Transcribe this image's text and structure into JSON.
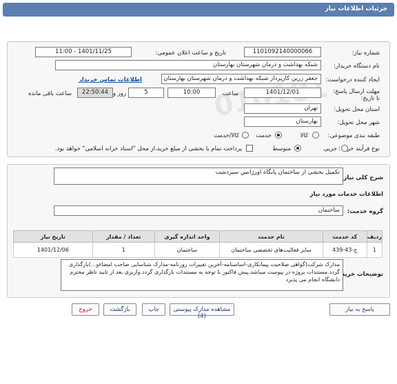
{
  "title": "جزئیات اطلاعات نیاز",
  "form": {
    "need_number_label": "شماره نیاز:",
    "need_number": "1101092140000066",
    "announce_label": "تاریخ و ساعت اعلان عمومی:",
    "announce_value": "1401/11/25 - 11:00",
    "buyer_label": "نام دستگاه خریدار:",
    "buyer_value": "شبکه بهداشت و درمان شهرستان بهارستان",
    "creator_label": "ایجاد کننده درخواست:",
    "creator_value": "جعفر زرین کارپرداز شبکه بهداشت و درمان شهرستان بهارستان",
    "contact_link": "اطلاعات تماس خریدار",
    "deadline_label": "مهلت ارسال پاسخ: تا تاریخ:",
    "deadline_date": "1401/12/01",
    "time_label": "ساعت",
    "deadline_time": "10:00",
    "days_value": "5",
    "days_label": "روز و",
    "remaining_time": "22:50:44",
    "remaining_label": "ساعت باقی مانده",
    "province_label": "استان محل تحویل:",
    "province_value": "تهران",
    "city_label": "شهر محل تحویل:",
    "city_value": "بهارستان",
    "category_label": "طبقه بندی موضوعی:",
    "category_options": [
      "کالا",
      "خدمت",
      "کالا/خدمت"
    ],
    "process_label": "نوع فرآیند خرید :",
    "process_options": [
      "جزیی",
      "متوسط"
    ],
    "payment_note": "پرداخت تمام یا بخشی از مبلغ خرید،از محل \"اسناد خزانه اسلامی\" خواهد بود."
  },
  "details": {
    "summary_label": "شرح کلی نیاز:",
    "summary_value": "تکمیل بخشی از ساختمان پایگاه اورژانس سیردشت",
    "services_heading": "اطلاعات خدمات مورد نیاز",
    "group_label": "گروه خدمت:",
    "group_value": "ساختمان",
    "table_headers": [
      "ردیف",
      "کد خدمت",
      "نام خدمت",
      "واحد اندازه گیری",
      "تعداد / مقدار",
      "تاریخ نیاز"
    ],
    "rows": [
      [
        "1",
        "ج-43-439",
        "سایر فعالیت‌های تخصصی ساختمان",
        "ساختمان",
        "1",
        "1401/12/06"
      ]
    ],
    "buyer_notes_label": "توضیحات خریدار:",
    "buyer_notes": "مدارک شرکت(گواهی صلاحیت پیمانکاری-اساسنامه-آخرین تغییرات روزنامه-مدارک شناسایی صاحب امضاءو...)بارگذاری گردد.مستندات پروژه در پیوست میباشد.پیش فاکتور با توجه به مستندات بارگذاری گردد.واریزی بعد از تایید ناظر محترم دانشگاه انجام می پذیرد"
  },
  "buttons": {
    "reply": "پاسخ به نیاز",
    "attachments": "مشاهده مدارک پیوستی (4)",
    "print": "چاپ",
    "back": "بازگشت",
    "exit": "خروج"
  },
  "colors": {
    "titlebar": "#5a7fb0",
    "link": "#1a4fa0",
    "exit": "#c8102e"
  }
}
